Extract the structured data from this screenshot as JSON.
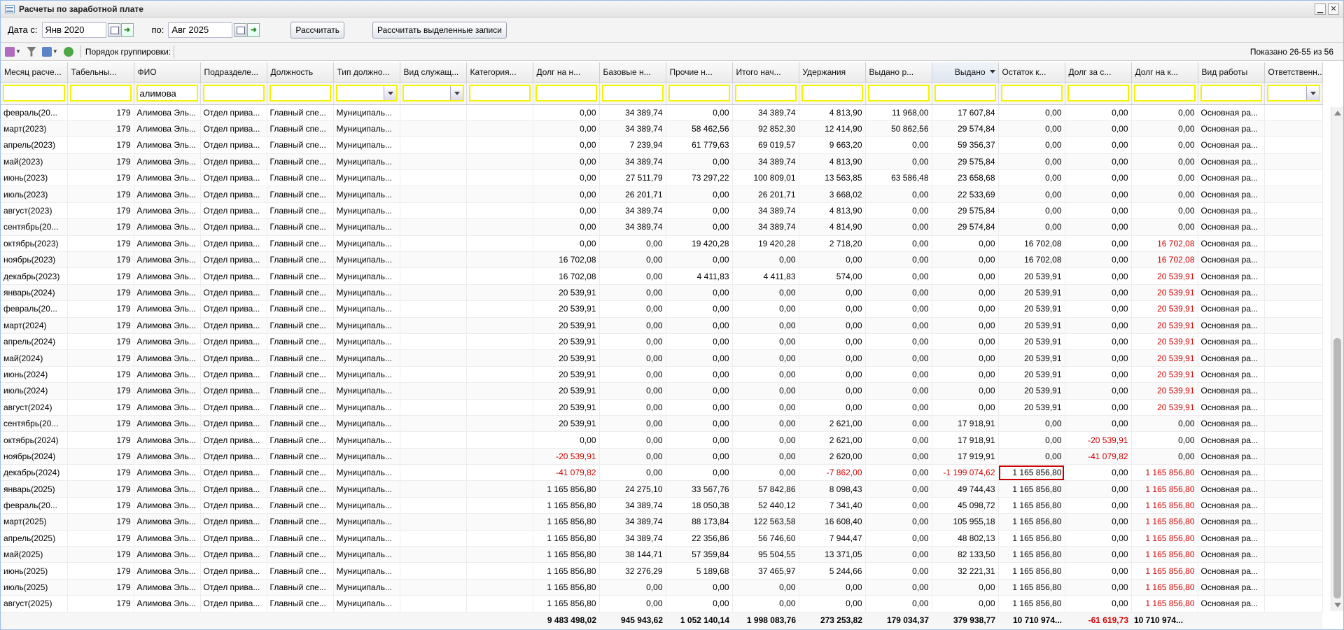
{
  "window": {
    "title": "Расчеты по заработной плате"
  },
  "filter": {
    "date_from_label": "Дата с:",
    "date_from": "Янв 2020",
    "date_to_label": "по:",
    "date_to": "Авг 2025",
    "calc_button": "Рассчитать",
    "calc_selected_button": "Рассчитать выделенные записи"
  },
  "toolbar": {
    "grouping_label": "Порядок группировки:",
    "shown_text": "Показано 26-55 из 56"
  },
  "columns": [
    "Месяц расче...",
    "Табельны...",
    "ФИО",
    "Подразделе...",
    "Должность",
    "Тип должно...",
    "Вид служащ...",
    "Категория...",
    "Долг на н...",
    "Базовые н...",
    "Прочие н...",
    "Итого нач...",
    "Удержания",
    "Выдано р...",
    "Выдано",
    "Остаток к...",
    "Долг за с...",
    "Долг на к...",
    "Вид работы",
    "Ответственн..."
  ],
  "filter_row": {
    "fio": "алимова"
  },
  "rows": [
    {
      "m": "февраль(20...",
      "tab": "179",
      "fio": "Алимова Эль...",
      "dep": "Отдел прива...",
      "pos": "Главный спе...",
      "type": "Муниципаль...",
      "debt_start": "0,00",
      "base": "34 389,74",
      "other": "0,00",
      "total": "34 389,74",
      "ded": "4 813,90",
      "paid_r": "11 968,00",
      "paid": "17 607,84",
      "rest": "0,00",
      "debt_s": "0,00",
      "debt_end": "0,00",
      "work": "Основная ра..."
    },
    {
      "m": "март(2023)",
      "tab": "179",
      "fio": "Алимова Эль...",
      "dep": "Отдел прива...",
      "pos": "Главный спе...",
      "type": "Муниципаль...",
      "debt_start": "0,00",
      "base": "34 389,74",
      "other": "58 462,56",
      "total": "92 852,30",
      "ded": "12 414,90",
      "paid_r": "50 862,56",
      "paid": "29 574,84",
      "rest": "0,00",
      "debt_s": "0,00",
      "debt_end": "0,00",
      "work": "Основная ра..."
    },
    {
      "m": "апрель(2023)",
      "tab": "179",
      "fio": "Алимова Эль...",
      "dep": "Отдел прива...",
      "pos": "Главный спе...",
      "type": "Муниципаль...",
      "debt_start": "0,00",
      "base": "7 239,94",
      "other": "61 779,63",
      "total": "69 019,57",
      "ded": "9 663,20",
      "paid_r": "0,00",
      "paid": "59 356,37",
      "rest": "0,00",
      "debt_s": "0,00",
      "debt_end": "0,00",
      "work": "Основная ра..."
    },
    {
      "m": "май(2023)",
      "tab": "179",
      "fio": "Алимова Эль...",
      "dep": "Отдел прива...",
      "pos": "Главный спе...",
      "type": "Муниципаль...",
      "debt_start": "0,00",
      "base": "34 389,74",
      "other": "0,00",
      "total": "34 389,74",
      "ded": "4 813,90",
      "paid_r": "0,00",
      "paid": "29 575,84",
      "rest": "0,00",
      "debt_s": "0,00",
      "debt_end": "0,00",
      "work": "Основная ра..."
    },
    {
      "m": "июнь(2023)",
      "tab": "179",
      "fio": "Алимова Эль...",
      "dep": "Отдел прива...",
      "pos": "Главный спе...",
      "type": "Муниципаль...",
      "debt_start": "0,00",
      "base": "27 511,79",
      "other": "73 297,22",
      "total": "100 809,01",
      "ded": "13 563,85",
      "paid_r": "63 586,48",
      "paid": "23 658,68",
      "rest": "0,00",
      "debt_s": "0,00",
      "debt_end": "0,00",
      "work": "Основная ра..."
    },
    {
      "m": "июль(2023)",
      "tab": "179",
      "fio": "Алимова Эль...",
      "dep": "Отдел прива...",
      "pos": "Главный спе...",
      "type": "Муниципаль...",
      "debt_start": "0,00",
      "base": "26 201,71",
      "other": "0,00",
      "total": "26 201,71",
      "ded": "3 668,02",
      "paid_r": "0,00",
      "paid": "22 533,69",
      "rest": "0,00",
      "debt_s": "0,00",
      "debt_end": "0,00",
      "work": "Основная ра..."
    },
    {
      "m": "август(2023)",
      "tab": "179",
      "fio": "Алимова Эль...",
      "dep": "Отдел прива...",
      "pos": "Главный спе...",
      "type": "Муниципаль...",
      "debt_start": "0,00",
      "base": "34 389,74",
      "other": "0,00",
      "total": "34 389,74",
      "ded": "4 813,90",
      "paid_r": "0,00",
      "paid": "29 575,84",
      "rest": "0,00",
      "debt_s": "0,00",
      "debt_end": "0,00",
      "work": "Основная ра..."
    },
    {
      "m": "сентябрь(20...",
      "tab": "179",
      "fio": "Алимова Эль...",
      "dep": "Отдел прива...",
      "pos": "Главный спе...",
      "type": "Муниципаль...",
      "debt_start": "0,00",
      "base": "34 389,74",
      "other": "0,00",
      "total": "34 389,74",
      "ded": "4 814,90",
      "paid_r": "0,00",
      "paid": "29 574,84",
      "rest": "0,00",
      "debt_s": "0,00",
      "debt_end": "0,00",
      "work": "Основная ра..."
    },
    {
      "m": "октябрь(2023)",
      "tab": "179",
      "fio": "Алимова Эль...",
      "dep": "Отдел прива...",
      "pos": "Главный спе...",
      "type": "Муниципаль...",
      "debt_start": "0,00",
      "base": "0,00",
      "other": "19 420,28",
      "total": "19 420,28",
      "ded": "2 718,20",
      "paid_r": "0,00",
      "paid": "0,00",
      "rest": "16 702,08",
      "debt_s": "0,00",
      "debt_end": "16 702,08",
      "debt_end_neg": true,
      "work": "Основная ра..."
    },
    {
      "m": "ноябрь(2023)",
      "tab": "179",
      "fio": "Алимова Эль...",
      "dep": "Отдел прива...",
      "pos": "Главный спе...",
      "type": "Муниципаль...",
      "debt_start": "16 702,08",
      "base": "0,00",
      "other": "0,00",
      "total": "0,00",
      "ded": "0,00",
      "paid_r": "0,00",
      "paid": "0,00",
      "rest": "16 702,08",
      "debt_s": "0,00",
      "debt_end": "16 702,08",
      "debt_end_neg": true,
      "work": "Основная ра..."
    },
    {
      "m": "декабрь(2023)",
      "tab": "179",
      "fio": "Алимова Эль...",
      "dep": "Отдел прива...",
      "pos": "Главный спе...",
      "type": "Муниципаль...",
      "debt_start": "16 702,08",
      "base": "0,00",
      "other": "4 411,83",
      "total": "4 411,83",
      "ded": "574,00",
      "paid_r": "0,00",
      "paid": "0,00",
      "rest": "20 539,91",
      "debt_s": "0,00",
      "debt_end": "20 539,91",
      "debt_end_neg": true,
      "work": "Основная ра..."
    },
    {
      "m": "январь(2024)",
      "tab": "179",
      "fio": "Алимова Эль...",
      "dep": "Отдел прива...",
      "pos": "Главный спе...",
      "type": "Муниципаль...",
      "debt_start": "20 539,91",
      "base": "0,00",
      "other": "0,00",
      "total": "0,00",
      "ded": "0,00",
      "paid_r": "0,00",
      "paid": "0,00",
      "rest": "20 539,91",
      "debt_s": "0,00",
      "debt_end": "20 539,91",
      "debt_end_neg": true,
      "work": "Основная ра..."
    },
    {
      "m": "февраль(20...",
      "tab": "179",
      "fio": "Алимова Эль...",
      "dep": "Отдел прива...",
      "pos": "Главный спе...",
      "type": "Муниципаль...",
      "debt_start": "20 539,91",
      "base": "0,00",
      "other": "0,00",
      "total": "0,00",
      "ded": "0,00",
      "paid_r": "0,00",
      "paid": "0,00",
      "rest": "20 539,91",
      "debt_s": "0,00",
      "debt_end": "20 539,91",
      "debt_end_neg": true,
      "work": "Основная ра..."
    },
    {
      "m": "март(2024)",
      "tab": "179",
      "fio": "Алимова Эль...",
      "dep": "Отдел прива...",
      "pos": "Главный спе...",
      "type": "Муниципаль...",
      "debt_start": "20 539,91",
      "base": "0,00",
      "other": "0,00",
      "total": "0,00",
      "ded": "0,00",
      "paid_r": "0,00",
      "paid": "0,00",
      "rest": "20 539,91",
      "debt_s": "0,00",
      "debt_end": "20 539,91",
      "debt_end_neg": true,
      "work": "Основная ра..."
    },
    {
      "m": "апрель(2024)",
      "tab": "179",
      "fio": "Алимова Эль...",
      "dep": "Отдел прива...",
      "pos": "Главный спе...",
      "type": "Муниципаль...",
      "debt_start": "20 539,91",
      "base": "0,00",
      "other": "0,00",
      "total": "0,00",
      "ded": "0,00",
      "paid_r": "0,00",
      "paid": "0,00",
      "rest": "20 539,91",
      "debt_s": "0,00",
      "debt_end": "20 539,91",
      "debt_end_neg": true,
      "work": "Основная ра..."
    },
    {
      "m": "май(2024)",
      "tab": "179",
      "fio": "Алимова Эль...",
      "dep": "Отдел прива...",
      "pos": "Главный спе...",
      "type": "Муниципаль...",
      "debt_start": "20 539,91",
      "base": "0,00",
      "other": "0,00",
      "total": "0,00",
      "ded": "0,00",
      "paid_r": "0,00",
      "paid": "0,00",
      "rest": "20 539,91",
      "debt_s": "0,00",
      "debt_end": "20 539,91",
      "debt_end_neg": true,
      "work": "Основная ра..."
    },
    {
      "m": "июнь(2024)",
      "tab": "179",
      "fio": "Алимова Эль...",
      "dep": "Отдел прива...",
      "pos": "Главный спе...",
      "type": "Муниципаль...",
      "debt_start": "20 539,91",
      "base": "0,00",
      "other": "0,00",
      "total": "0,00",
      "ded": "0,00",
      "paid_r": "0,00",
      "paid": "0,00",
      "rest": "20 539,91",
      "debt_s": "0,00",
      "debt_end": "20 539,91",
      "debt_end_neg": true,
      "work": "Основная ра..."
    },
    {
      "m": "июль(2024)",
      "tab": "179",
      "fio": "Алимова Эль...",
      "dep": "Отдел прива...",
      "pos": "Главный спе...",
      "type": "Муниципаль...",
      "debt_start": "20 539,91",
      "base": "0,00",
      "other": "0,00",
      "total": "0,00",
      "ded": "0,00",
      "paid_r": "0,00",
      "paid": "0,00",
      "rest": "20 539,91",
      "debt_s": "0,00",
      "debt_end": "20 539,91",
      "debt_end_neg": true,
      "work": "Основная ра..."
    },
    {
      "m": "август(2024)",
      "tab": "179",
      "fio": "Алимова Эль...",
      "dep": "Отдел прива...",
      "pos": "Главный спе...",
      "type": "Муниципаль...",
      "debt_start": "20 539,91",
      "base": "0,00",
      "other": "0,00",
      "total": "0,00",
      "ded": "0,00",
      "paid_r": "0,00",
      "paid": "0,00",
      "rest": "20 539,91",
      "debt_s": "0,00",
      "debt_end": "20 539,91",
      "debt_end_neg": true,
      "work": "Основная ра..."
    },
    {
      "m": "сентябрь(20...",
      "tab": "179",
      "fio": "Алимова Эль...",
      "dep": "Отдел прива...",
      "pos": "Главный спе...",
      "type": "Муниципаль...",
      "debt_start": "20 539,91",
      "base": "0,00",
      "other": "0,00",
      "total": "0,00",
      "ded": "2 621,00",
      "paid_r": "0,00",
      "paid": "17 918,91",
      "rest": "0,00",
      "debt_s": "0,00",
      "debt_end": "0,00",
      "work": "Основная ра..."
    },
    {
      "m": "октябрь(2024)",
      "tab": "179",
      "fio": "Алимова Эль...",
      "dep": "Отдел прива...",
      "pos": "Главный спе...",
      "type": "Муниципаль...",
      "debt_start": "0,00",
      "base": "0,00",
      "other": "0,00",
      "total": "0,00",
      "ded": "2 621,00",
      "paid_r": "0,00",
      "paid": "17 918,91",
      "rest": "0,00",
      "debt_s": "-20 539,91",
      "debt_s_neg": true,
      "debt_end": "0,00",
      "work": "Основная ра..."
    },
    {
      "m": "ноябрь(2024)",
      "tab": "179",
      "fio": "Алимова Эль...",
      "dep": "Отдел прива...",
      "pos": "Главный спе...",
      "type": "Муниципаль...",
      "debt_start": "-20 539,91",
      "debt_start_neg": true,
      "base": "0,00",
      "other": "0,00",
      "total": "0,00",
      "ded": "2 620,00",
      "paid_r": "0,00",
      "paid": "17 919,91",
      "rest": "0,00",
      "debt_s": "-41 079,82",
      "debt_s_neg": true,
      "debt_end": "0,00",
      "work": "Основная ра..."
    },
    {
      "m": "декабрь(2024)",
      "tab": "179",
      "fio": "Алимова Эль...",
      "dep": "Отдел прива...",
      "pos": "Главный спе...",
      "type": "Муниципаль...",
      "debt_start": "-41 079,82",
      "debt_start_neg": true,
      "base": "0,00",
      "other": "0,00",
      "total": "0,00",
      "ded": "-7 862,00",
      "ded_neg": true,
      "paid_r": "0,00",
      "paid": "-1 199 074,62",
      "paid_neg": true,
      "rest": "1 165 856,80",
      "rest_hl": true,
      "debt_s": "0,00",
      "debt_end": "1 165 856,80",
      "debt_end_neg": true,
      "work": "Основная ра..."
    },
    {
      "m": "январь(2025)",
      "tab": "179",
      "fio": "Алимова Эль...",
      "dep": "Отдел прива...",
      "pos": "Главный спе...",
      "type": "Муниципаль...",
      "debt_start": "1 165 856,80",
      "base": "24 275,10",
      "other": "33 567,76",
      "total": "57 842,86",
      "ded": "8 098,43",
      "paid_r": "0,00",
      "paid": "49 744,43",
      "rest": "1 165 856,80",
      "debt_s": "0,00",
      "debt_end": "1 165 856,80",
      "debt_end_neg": true,
      "work": "Основная ра..."
    },
    {
      "m": "февраль(20...",
      "tab": "179",
      "fio": "Алимова Эль...",
      "dep": "Отдел прива...",
      "pos": "Главный спе...",
      "type": "Муниципаль...",
      "debt_start": "1 165 856,80",
      "base": "34 389,74",
      "other": "18 050,38",
      "total": "52 440,12",
      "ded": "7 341,40",
      "paid_r": "0,00",
      "paid": "45 098,72",
      "rest": "1 165 856,80",
      "debt_s": "0,00",
      "debt_end": "1 165 856,80",
      "debt_end_neg": true,
      "work": "Основная ра..."
    },
    {
      "m": "март(2025)",
      "tab": "179",
      "fio": "Алимова Эль...",
      "dep": "Отдел прива...",
      "pos": "Главный спе...",
      "type": "Муниципаль...",
      "debt_start": "1 165 856,80",
      "base": "34 389,74",
      "other": "88 173,84",
      "total": "122 563,58",
      "ded": "16 608,40",
      "paid_r": "0,00",
      "paid": "105 955,18",
      "rest": "1 165 856,80",
      "debt_s": "0,00",
      "debt_end": "1 165 856,80",
      "debt_end_neg": true,
      "work": "Основная ра..."
    },
    {
      "m": "апрель(2025)",
      "tab": "179",
      "fio": "Алимова Эль...",
      "dep": "Отдел прива...",
      "pos": "Главный спе...",
      "type": "Муниципаль...",
      "debt_start": "1 165 856,80",
      "base": "34 389,74",
      "other": "22 356,86",
      "total": "56 746,60",
      "ded": "7 944,47",
      "paid_r": "0,00",
      "paid": "48 802,13",
      "rest": "1 165 856,80",
      "debt_s": "0,00",
      "debt_end": "1 165 856,80",
      "debt_end_neg": true,
      "work": "Основная ра..."
    },
    {
      "m": "май(2025)",
      "tab": "179",
      "fio": "Алимова Эль...",
      "dep": "Отдел прива...",
      "pos": "Главный спе...",
      "type": "Муниципаль...",
      "debt_start": "1 165 856,80",
      "base": "38 144,71",
      "other": "57 359,84",
      "total": "95 504,55",
      "ded": "13 371,05",
      "paid_r": "0,00",
      "paid": "82 133,50",
      "rest": "1 165 856,80",
      "debt_s": "0,00",
      "debt_end": "1 165 856,80",
      "debt_end_neg": true,
      "work": "Основная ра..."
    },
    {
      "m": "июнь(2025)",
      "tab": "179",
      "fio": "Алимова Эль...",
      "dep": "Отдел прива...",
      "pos": "Главный спе...",
      "type": "Муниципаль...",
      "debt_start": "1 165 856,80",
      "base": "32 276,29",
      "other": "5 189,68",
      "total": "37 465,97",
      "ded": "5 244,66",
      "paid_r": "0,00",
      "paid": "32 221,31",
      "rest": "1 165 856,80",
      "debt_s": "0,00",
      "debt_end": "1 165 856,80",
      "debt_end_neg": true,
      "work": "Основная ра..."
    },
    {
      "m": "июль(2025)",
      "tab": "179",
      "fio": "Алимова Эль...",
      "dep": "Отдел прива...",
      "pos": "Главный спе...",
      "type": "Муниципаль...",
      "debt_start": "1 165 856,80",
      "base": "0,00",
      "other": "0,00",
      "total": "0,00",
      "ded": "0,00",
      "paid_r": "0,00",
      "paid": "0,00",
      "rest": "1 165 856,80",
      "debt_s": "0,00",
      "debt_end": "1 165 856,80",
      "debt_end_neg": true,
      "work": "Основная ра..."
    },
    {
      "m": "август(2025)",
      "tab": "179",
      "fio": "Алимова Эль...",
      "dep": "Отдел прива...",
      "pos": "Главный спе...",
      "type": "Муниципаль...",
      "debt_start": "1 165 856,80",
      "base": "0,00",
      "other": "0,00",
      "total": "0,00",
      "ded": "0,00",
      "paid_r": "0,00",
      "paid": "0,00",
      "rest": "1 165 856,80",
      "debt_s": "0,00",
      "debt_end": "1 165 856,80",
      "debt_end_neg": true,
      "work": "Основная ра..."
    }
  ],
  "totals": {
    "debt_start": "9 483 498,02",
    "base": "945 943,62",
    "other": "1 052 140,14",
    "total": "1 998 083,76",
    "ded": "273 253,82",
    "paid_r": "179 034,37",
    "paid": "379 938,77",
    "rest": "10 710 974...",
    "debt_s": "-61 619,73",
    "debt_end": "10 710 974..."
  },
  "colors": {
    "accent": "#99bbe8",
    "filter_highlight": "#f4f400",
    "negative": "#d00000",
    "selection_outline": "#cc0000"
  }
}
